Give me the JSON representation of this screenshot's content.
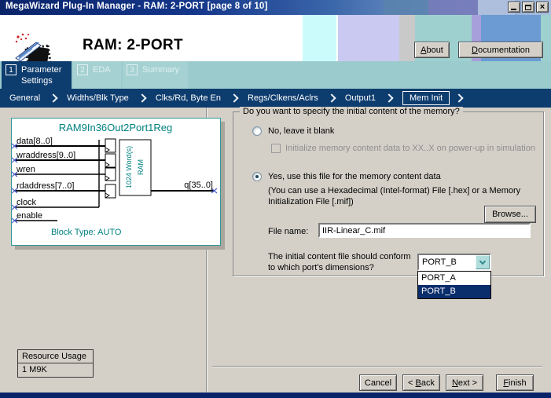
{
  "window": {
    "title": "MegaWizard Plug-In Manager - RAM: 2-PORT [page 8 of 10]"
  },
  "header": {
    "title": "RAM: 2-PORT",
    "about_label": "About",
    "documentation_label": "Documentation"
  },
  "tabs": [
    {
      "num": "1",
      "label": "Parameter Settings",
      "active": true
    },
    {
      "num": "2",
      "label": "EDA",
      "active": false
    },
    {
      "num": "3",
      "label": "Summary",
      "active": false
    }
  ],
  "breadcrumb": {
    "items": [
      "General",
      "Widths/Blk Type",
      "Clks/Rd, Byte En",
      "Regs/Clkens/Aclrs",
      "Output1",
      "Mem Init"
    ],
    "active": "Mem Init"
  },
  "diagram": {
    "title": "RAM9In36Out2Port1Reg",
    "ports_in": [
      "data[8..0]",
      "wraddress[9..0]",
      "wren",
      "rdaddress[7..0]",
      "clock",
      "enable"
    ],
    "port_out": "q[35..0]",
    "ram_label_1": "1024 Word(s)",
    "ram_label_2": "RAM",
    "block_type": "Block Type: AUTO"
  },
  "memory_panel": {
    "legend": "Do you want to specify the initial content of the memory?",
    "radio_no": "No, leave it blank",
    "checkbox_init": "Initialize memory content data to XX..X on power-up in simulation",
    "radio_yes": "Yes, use this file for the memory content data",
    "yes_note_line1": "(You can use a Hexadecimal (Intel-format) File [.hex] or a Memory",
    "yes_note_line2": "Initialization File [.mif])",
    "browse_label": "Browse...",
    "file_name_label": "File name:",
    "file_name_value": "IIR-Linear_C.mif",
    "conform_line1": "The initial content file should conform",
    "conform_line2": "to which port's dimensions?",
    "port_select": {
      "value": "PORT_B",
      "options": [
        "PORT_A",
        "PORT_B"
      ],
      "highlighted": "PORT_B"
    }
  },
  "resource_usage": {
    "header": "Resource Usage",
    "value": "1 M9K"
  },
  "footer": {
    "cancel_label": "Cancel",
    "back_label": "< Back",
    "next_label": "Next >",
    "finish_label": "Finish"
  },
  "accelerators": {
    "about-button": "A",
    "documentation-button": "D",
    "back-button": "B",
    "next-button": "N",
    "finish-button": "F"
  },
  "colors": {
    "title_bar_navy": "#0a246a",
    "navy": "#0d3c6e",
    "teal_band": "#9bcbcd",
    "content_bg": "#d4d0c8",
    "diagram_accent": "#008080",
    "selection_bg": "#0a2d6b",
    "combo_button": "#b2dddd"
  }
}
